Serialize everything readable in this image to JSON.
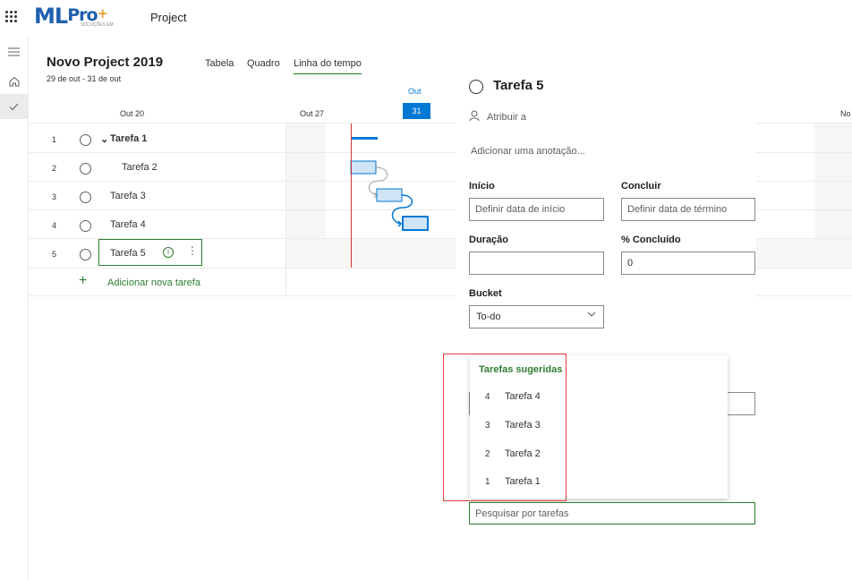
{
  "app": {
    "logo_ml": "ML",
    "logo_pro": "Pro",
    "logo_plus": "+",
    "logo_sub": "SOLUÇÕES EM",
    "title": "Project"
  },
  "project": {
    "title": "Novo Project 2019",
    "dates": "29 de out - 31 de out"
  },
  "tabs": [
    {
      "label": "Tabela"
    },
    {
      "label": "Quadro"
    },
    {
      "label": "Linha do tempo",
      "active": true
    }
  ],
  "timeline": {
    "month": "Out",
    "today": "31",
    "weeks": [
      "Out 20",
      "Out 27",
      "No"
    ]
  },
  "tasks": [
    {
      "num": "1",
      "name": "Tarefa 1"
    },
    {
      "num": "2",
      "name": "Tarefa 2"
    },
    {
      "num": "3",
      "name": "Tarefa 3"
    },
    {
      "num": "4",
      "name": "Tarefa 4"
    },
    {
      "num": "5",
      "name": "Tarefa 5"
    }
  ],
  "add_task": "Adicionar nova tarefa",
  "detail": {
    "title": "Tarefa 5",
    "assign": "Atribuir a",
    "note": "Adicionar uma anotação...",
    "start_label": "Início",
    "start_placeholder": "Definir data de início",
    "end_label": "Concluir",
    "end_placeholder": "Definir data de término",
    "duration_label": "Duração",
    "duration_value": "",
    "percent_label": "% Concluído",
    "percent_value": "0",
    "bucket_label": "Bucket",
    "bucket_value": "To-do"
  },
  "suggestions": {
    "title": "Tarefas sugeridas",
    "items": [
      {
        "num": "4",
        "name": "Tarefa 4"
      },
      {
        "num": "3",
        "name": "Tarefa 3"
      },
      {
        "num": "2",
        "name": "Tarefa 2"
      },
      {
        "num": "1",
        "name": "Tarefa 1"
      }
    ],
    "search_placeholder": "Pesquisar por tarefas"
  },
  "colors": {
    "accent_green": "#2e7d32",
    "today_blue": "#0078d4",
    "today_line": "#d13438",
    "highlight_box": "#e03c3c"
  },
  "icons": [
    "waffle-icon",
    "hamburger-icon",
    "home-icon",
    "check-icon",
    "person-icon",
    "info-icon",
    "more-icon",
    "plus-icon",
    "chevron-down-icon"
  ]
}
